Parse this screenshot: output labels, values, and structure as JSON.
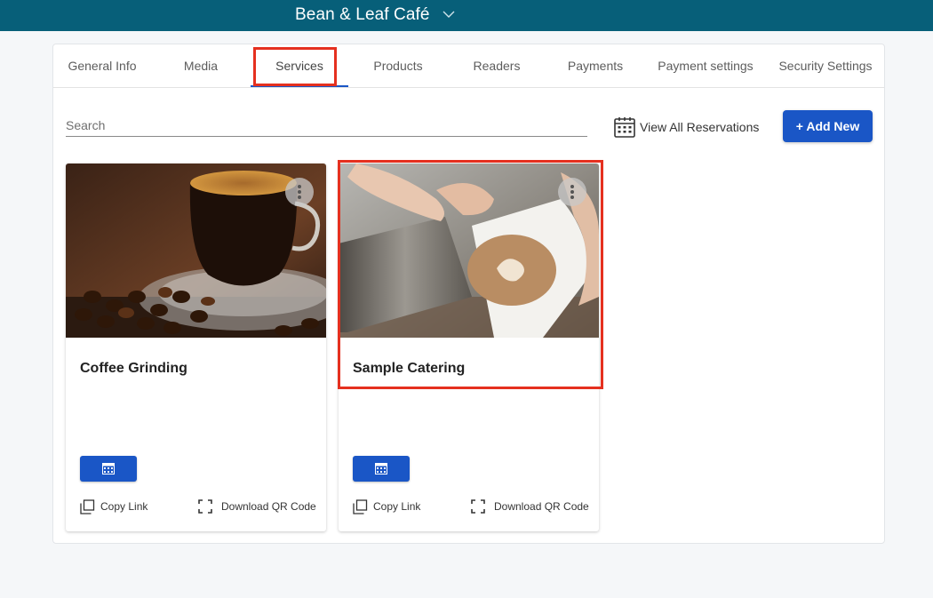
{
  "header": {
    "venue_name": "Bean & Leaf Café",
    "background": "#075f79"
  },
  "tabs": [
    {
      "label": "General Info",
      "active": false
    },
    {
      "label": "Media",
      "active": false
    },
    {
      "label": "Services",
      "active": true
    },
    {
      "label": "Products",
      "active": false
    },
    {
      "label": "Readers",
      "active": false
    },
    {
      "label": "Payments",
      "active": false
    },
    {
      "label": "Payment settings",
      "active": false
    },
    {
      "label": "Security Settings",
      "active": false
    }
  ],
  "toolbar": {
    "search_placeholder": "Search",
    "view_all_label": "View All Reservations",
    "add_new_label": "+ Add New"
  },
  "services": [
    {
      "title": "Coffee Grinding",
      "image": "espresso-cup-with-beans",
      "copy_link_label": "Copy Link",
      "qr_label": "Download QR Code"
    },
    {
      "title": "Sample Catering",
      "image": "latte-art-pour",
      "copy_link_label": "Copy Link",
      "qr_label": "Download QR Code"
    }
  ],
  "colors": {
    "accent": "#1a56c6",
    "highlight": "#e5301f",
    "page_bg": "#f5f7f9"
  },
  "icons": [
    "chevron-down-icon",
    "calendar-icon",
    "more-vert-icon",
    "copy-icon",
    "qr-code-icon"
  ]
}
